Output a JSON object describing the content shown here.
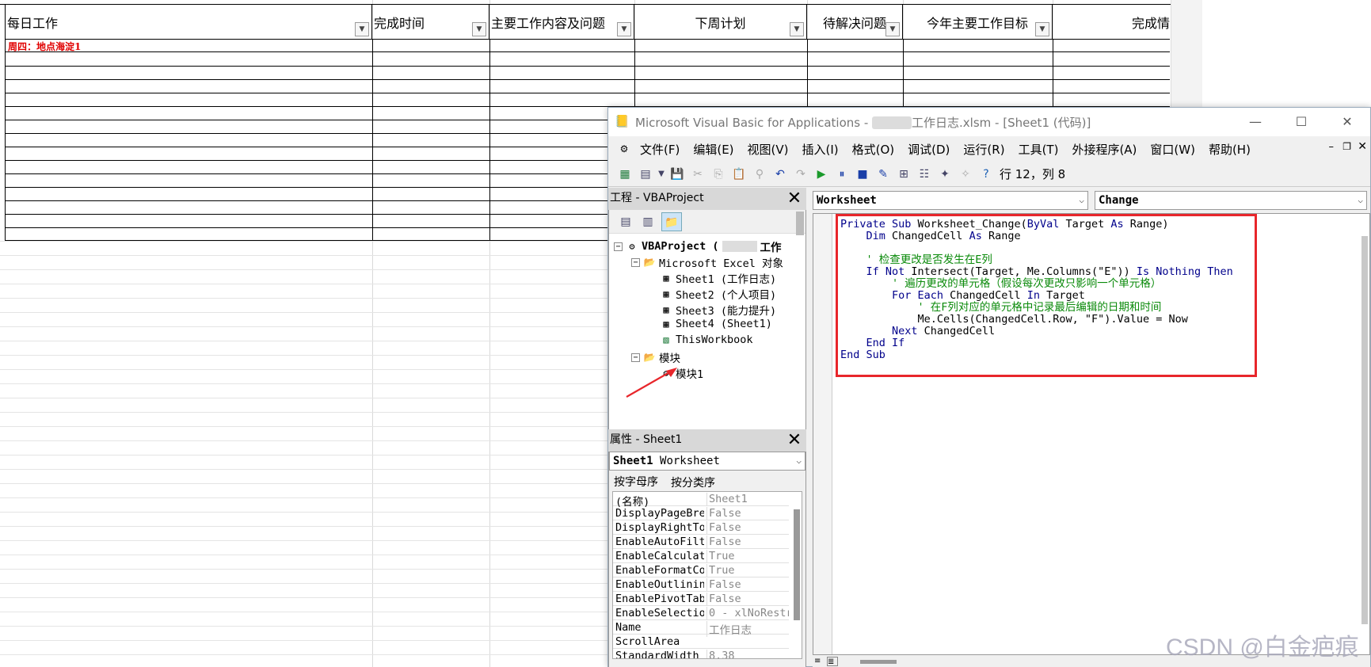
{
  "sheet": {
    "headers": [
      "每日工作",
      "完成时间",
      "主要工作内容及问题",
      "下周计划",
      "待解决问题",
      "今年主要工作目标",
      "完成情"
    ],
    "first_cell": "周四：地点海淀1"
  },
  "vba": {
    "title": "Microsoft Visual Basic for Applications - ",
    "title_file": "工作日志.xlsm - [Sheet1 (代码)]",
    "menus": [
      "文件(F)",
      "编辑(E)",
      "视图(V)",
      "插入(I)",
      "格式(O)",
      "调试(D)",
      "运行(R)",
      "工具(T)",
      "外接程序(A)",
      "窗口(W)",
      "帮助(H)"
    ],
    "position": "行 12，列 8",
    "project": {
      "header": "工程 - VBAProject",
      "root": "VBAProject (",
      "root_suffix": "工作",
      "objects_folder": "Microsoft Excel 对象",
      "items": [
        "Sheet1 (工作日志)",
        "Sheet2 (个人项目)",
        "Sheet3 (能力提升)",
        "Sheet4 (Sheet1)",
        "ThisWorkbook"
      ],
      "modules_folder": "模块",
      "modules": [
        "模块1"
      ]
    },
    "properties": {
      "header": "属性 - Sheet1",
      "object_name": "Sheet1",
      "object_type": "Worksheet",
      "tab_alpha": "按字母序",
      "tab_cat": "按分类序",
      "rows": [
        {
          "name": "(名称)",
          "value": "Sheet1"
        },
        {
          "name": "DisplayPageBre",
          "value": "False"
        },
        {
          "name": "DisplayRightTo",
          "value": "False"
        },
        {
          "name": "EnableAutoFilt",
          "value": "False"
        },
        {
          "name": "EnableCalculat",
          "value": "True"
        },
        {
          "name": "EnableFormatCo",
          "value": "True"
        },
        {
          "name": "EnableOutlinin",
          "value": "False"
        },
        {
          "name": "EnablePivotTab",
          "value": "False"
        },
        {
          "name": "EnableSelectio",
          "value": "0 - xlNoRestr"
        },
        {
          "name": "Name",
          "value": "工作日志"
        },
        {
          "name": "ScrollArea",
          "value": ""
        },
        {
          "name": "StandardWidth",
          "value": "8.38"
        }
      ]
    },
    "code": {
      "object_combo": "Worksheet",
      "proc_combo": "Change",
      "lines": [
        [
          {
            "t": "Private Sub ",
            "k": "kw"
          },
          {
            "t": "Worksheet_Change(",
            "k": ""
          },
          {
            "t": "ByVal",
            "k": "kw"
          },
          {
            "t": " Target ",
            "k": ""
          },
          {
            "t": "As",
            "k": "kw"
          },
          {
            "t": " Range)",
            "k": ""
          }
        ],
        [
          {
            "t": "    Dim ",
            "k": "kw"
          },
          {
            "t": "ChangedCell ",
            "k": ""
          },
          {
            "t": "As",
            "k": "kw"
          },
          {
            "t": " Range",
            "k": ""
          }
        ],
        [
          {
            "t": "",
            "k": ""
          }
        ],
        [
          {
            "t": "    ' 检查更改是否发生在E列",
            "k": "cm"
          }
        ],
        [
          {
            "t": "    If Not ",
            "k": "kw"
          },
          {
            "t": "Intersect(Target, Me.Columns(\"E\")) ",
            "k": ""
          },
          {
            "t": "Is Nothing Then",
            "k": "kw"
          }
        ],
        [
          {
            "t": "        ' 遍历更改的单元格（假设每次更改只影响一个单元格）",
            "k": "cm"
          }
        ],
        [
          {
            "t": "        For Each ",
            "k": "kw"
          },
          {
            "t": "ChangedCell ",
            "k": ""
          },
          {
            "t": "In",
            "k": "kw"
          },
          {
            "t": " Target",
            "k": ""
          }
        ],
        [
          {
            "t": "            ' 在F列对应的单元格中记录最后编辑的日期和时间",
            "k": "cm"
          }
        ],
        [
          {
            "t": "            Me.Cells(ChangedCell.Row, \"F\").Value = Now",
            "k": ""
          }
        ],
        [
          {
            "t": "        Next ",
            "k": "kw"
          },
          {
            "t": "ChangedCell",
            "k": ""
          }
        ],
        [
          {
            "t": "    End If",
            "k": "kw"
          }
        ],
        [
          {
            "t": "End Sub",
            "k": "kw"
          }
        ]
      ]
    }
  },
  "watermark": "CSDN @白金疤痕",
  "colors": {
    "highlight": "#e8262b",
    "keyword": "#00008b",
    "comment": "#0a8a0a"
  }
}
